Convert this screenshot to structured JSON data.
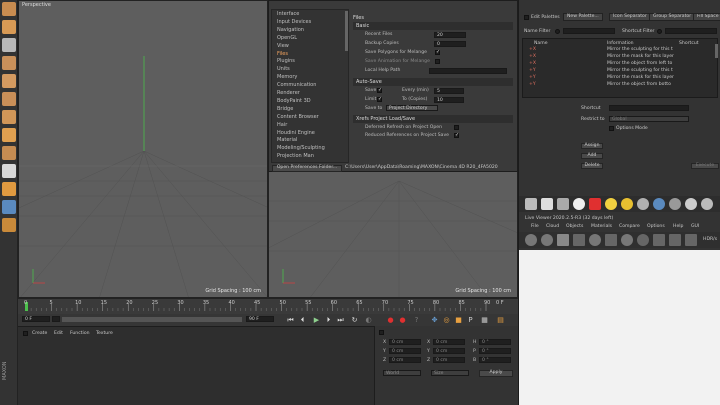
{
  "viewport_left": {
    "label": "Perspective",
    "grid": "Grid Spacing : 100 cm"
  },
  "viewport_right": {
    "grid": "Grid Spacing : 100 cm"
  },
  "prefs": {
    "nav": [
      "Interface",
      "Input Devices",
      "Navigation",
      "OpenGL",
      "View",
      "Files",
      "Plugins",
      "Units",
      "Memory",
      "Communication",
      "Renderer",
      "BodyPaint 3D",
      "Bridge",
      "Content Browser",
      "Hair",
      "Houdini Engine",
      "Material",
      "Modeling/Sculpting",
      "Projection Man"
    ],
    "nav_selected": 5,
    "title": "Files",
    "basic_header": "Basic",
    "recent_files_label": "Recent Files",
    "recent_files_value": "20",
    "backup_label": "Backup Copies",
    "backup_value": "0",
    "save_polygons": "Save Polygons for Melange",
    "save_animation": "Save Animation for Melange",
    "local_help": "Local Help Path",
    "autosave_header": "Auto-Save",
    "save_label": "Save",
    "every_label": "Every (min)",
    "every_value": "5",
    "limit_label": "Limit",
    "to_label": "To (Copies)",
    "to_value": "10",
    "save_to_label": "Save to",
    "save_to_value": "Project Directory",
    "xrefs_header": "Xrefs Project Load/Save",
    "deferred": "Deferred Refresh on Project Open",
    "reduced": "Reduced References on Project Save",
    "open_folder": "Open Preferences Folder...",
    "path": "C:\\Users\\User\\AppData\\Roaming\\MAXON\\Cinema 4D R20_4FA5020"
  },
  "right": {
    "edit_palettes": "Edit Palettes",
    "new_palette": "New Palette...",
    "icon_sep": "Icon Separator",
    "group_sep": "Group Separator",
    "fill_space": "Fill Space",
    "name_filter": "Name Filter",
    "shortcut_filter": "Shortcut Filter",
    "cols": [
      "Name",
      "Information",
      "Shortcut"
    ],
    "rows": [
      {
        "name": "+X",
        "info": "Mirror the sculpting for this t"
      },
      {
        "name": "+X",
        "info": "Mirror the mask for this layer"
      },
      {
        "name": "+X",
        "info": "Mirror the object from left to"
      },
      {
        "name": "+Y",
        "info": "Mirror the sculpting for this t"
      },
      {
        "name": "+Y",
        "info": "Mirror the mask for this layer"
      },
      {
        "name": "+Y",
        "info": "Mirror the object from botto"
      }
    ],
    "shortcut_label": "Shortcut",
    "restrict_label": "Restrict to",
    "restrict_value": "Global",
    "options_mode": "Options Mode",
    "assign": "Assign",
    "add": "Add",
    "delete": "Delete",
    "execute": "Execute",
    "lv_title": "Live Viewer 2020.2.5-R3 (32 days left)",
    "lv_menu": [
      "File",
      "Cloud",
      "Objects",
      "Materials",
      "Compare",
      "Options",
      "Help",
      "GUI"
    ],
    "hdr_label": "HDR/s"
  },
  "timeline": {
    "ticks": [
      "0",
      "5",
      "10",
      "15",
      "20",
      "25",
      "30",
      "35",
      "40",
      "45",
      "50",
      "55",
      "60",
      "65",
      "70",
      "75",
      "80",
      "85",
      "90"
    ],
    "frame_left": "0 F",
    "frame_start": "0 F",
    "frame_end": "90 F",
    "frame_end2": "90 F",
    "frame_cur": "0 F",
    "range_value": 0
  },
  "materials": {
    "menu": [
      "Create",
      "Edit",
      "Function",
      "Texture"
    ]
  },
  "coords": {
    "rows": [
      {
        "a": "X",
        "v1": "0 cm",
        "b": "X",
        "v2": "0 cm",
        "c": "H",
        "v3": "0 °"
      },
      {
        "a": "Y",
        "v1": "0 cm",
        "b": "Y",
        "v2": "0 cm",
        "c": "P",
        "v3": "0 °"
      },
      {
        "a": "Z",
        "v1": "0 cm",
        "b": "Z",
        "v2": "0 cm",
        "c": "B",
        "v3": "0 °"
      }
    ],
    "world": "World",
    "size": "Size",
    "apply": "Apply"
  },
  "side_label": "MAXON",
  "colors": {
    "accent": "#f4a460",
    "viewport": "#5e5e5e",
    "panel": "#333333"
  }
}
